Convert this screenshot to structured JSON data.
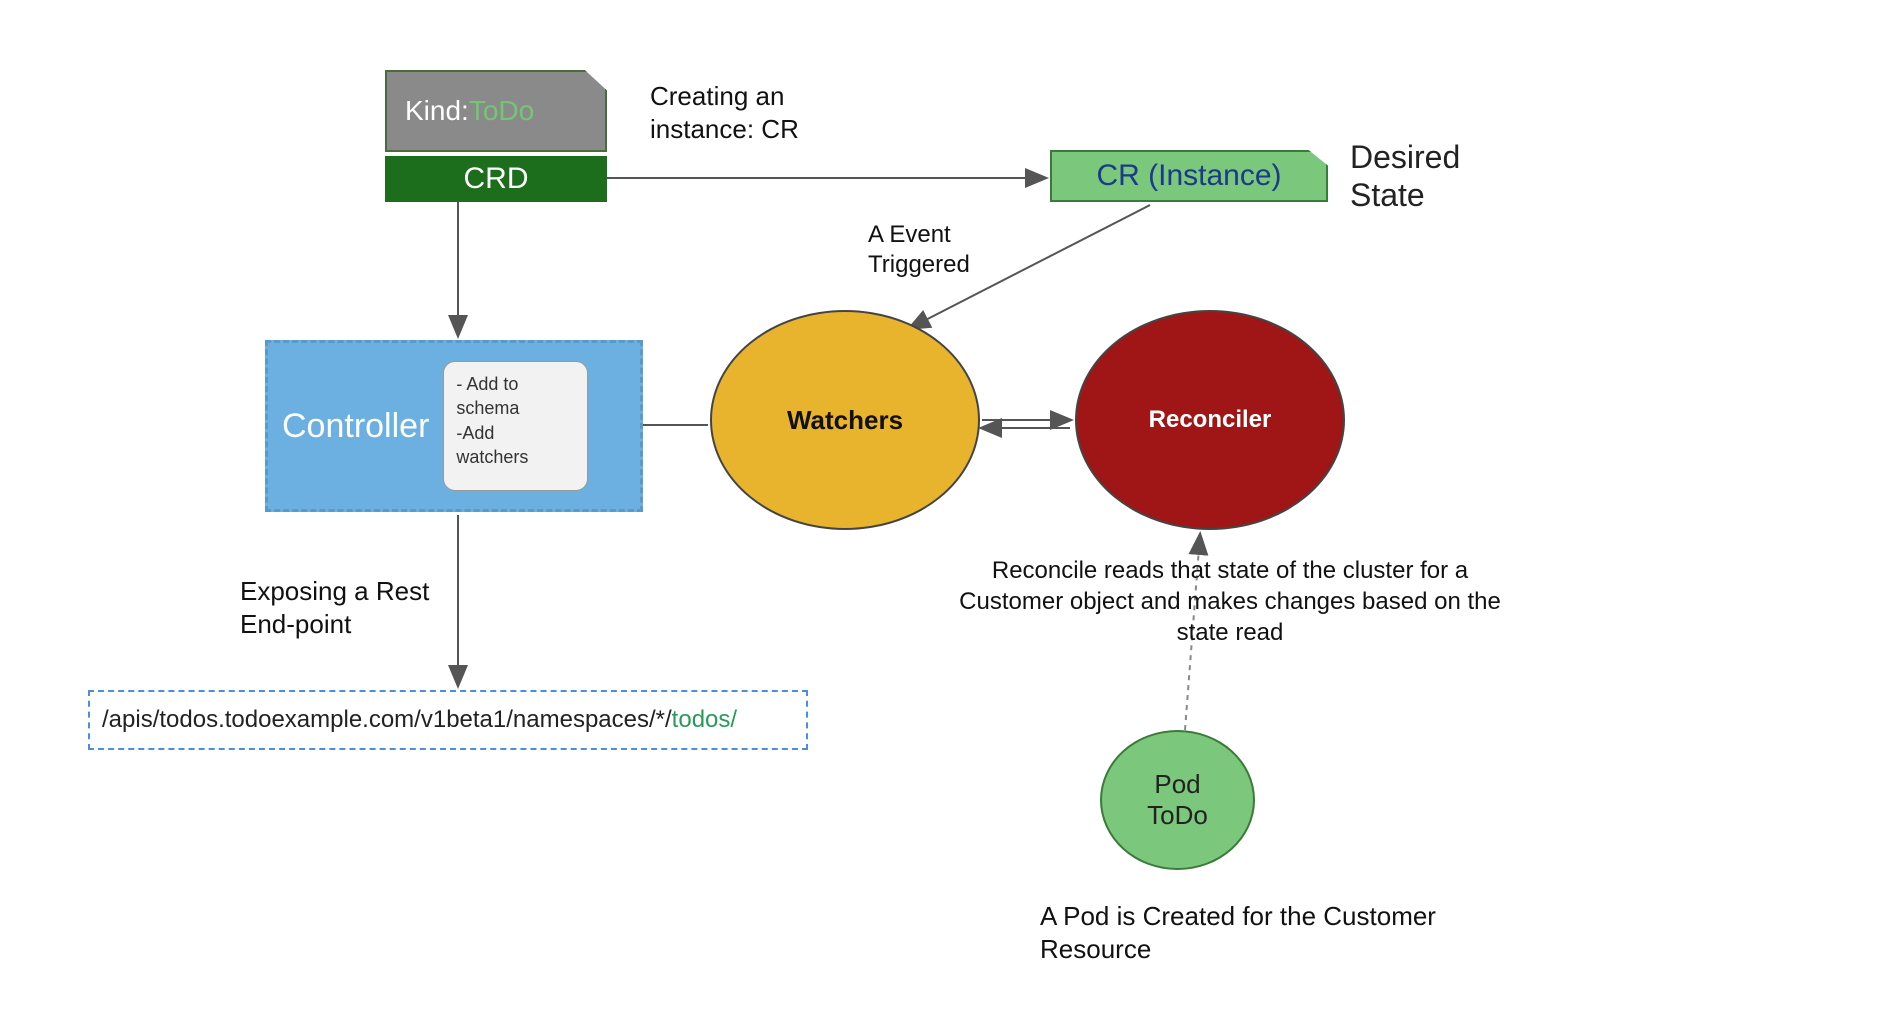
{
  "nodes": {
    "kind": {
      "label_key": "Kind:",
      "label_val": "ToDo"
    },
    "crd": {
      "label": "CRD"
    },
    "cr": {
      "label": "CR (Instance)"
    },
    "controller": {
      "title": "Controller",
      "notes_line1": "- Add to",
      "notes_line2": "schema",
      "notes_line3": "-Add",
      "notes_line4": "watchers"
    },
    "watchers": {
      "label": "Watchers"
    },
    "reconciler": {
      "label": "Reconciler"
    },
    "pod": {
      "line1": "Pod",
      "line2": "ToDo"
    }
  },
  "labels": {
    "creating_instance": "Creating an\ninstance: CR",
    "desired_state": "Desired\nState",
    "event_triggered": "A Event\nTriggered",
    "exposing_rest": "Exposing a Rest\nEnd-point",
    "reconcile_desc": "Reconcile reads that state of the cluster for a\nCustomer object and makes changes based on the\nstate read",
    "pod_note": "A Pod is Created for the Customer\nResource"
  },
  "api_path": {
    "prefix": "/apis/todos.todoexample.com/v1beta1/namespaces/*/",
    "suffix": "todos/"
  },
  "colors": {
    "gray": "#8A8A8A",
    "dark_green": "#1c6d1c",
    "light_green": "#7bc77b",
    "blue": "#6bb0e0",
    "yellow": "#e8b42e",
    "red": "#a01616",
    "dashed_blue": "#4a8ee0"
  }
}
